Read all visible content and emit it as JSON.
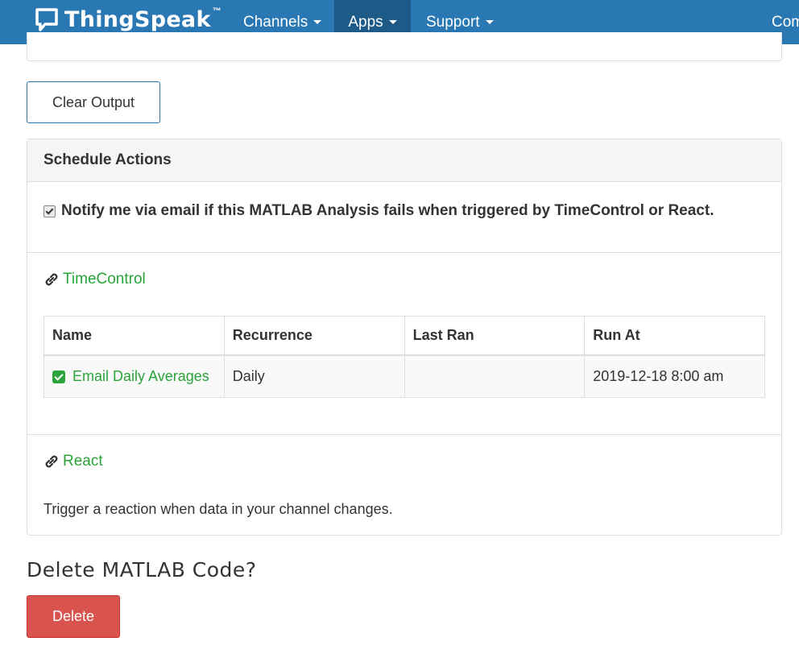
{
  "navbar": {
    "brand": "ThingSpeak",
    "trademark": "™",
    "items": [
      {
        "label": "Channels"
      },
      {
        "label": "Apps"
      },
      {
        "label": "Support"
      },
      {
        "label": "Com"
      }
    ]
  },
  "actions": {
    "clear_output": "Clear Output"
  },
  "schedule": {
    "heading": "Schedule Actions",
    "notify_label": "Notify me via email if this MATLAB Analysis fails when triggered by TimeControl or React.",
    "notify_checked": true,
    "timecontrol": {
      "label": "TimeControl",
      "columns": [
        "Name",
        "Recurrence",
        "Last Ran",
        "Run At"
      ],
      "rows": [
        {
          "name": "Email Daily Averages",
          "recurrence": "Daily",
          "last_ran": "",
          "run_at": "2019-12-18 8:00 am"
        }
      ]
    },
    "react": {
      "label": "React",
      "description": "Trigger a reaction when data in your channel changes."
    }
  },
  "delete": {
    "heading": "Delete MATLAB Code?",
    "button": "Delete"
  },
  "colors": {
    "navbar": "#2a78b3",
    "nav_active": "#1d5a87",
    "link_green": "#2aa33a",
    "danger": "#d9534f"
  }
}
